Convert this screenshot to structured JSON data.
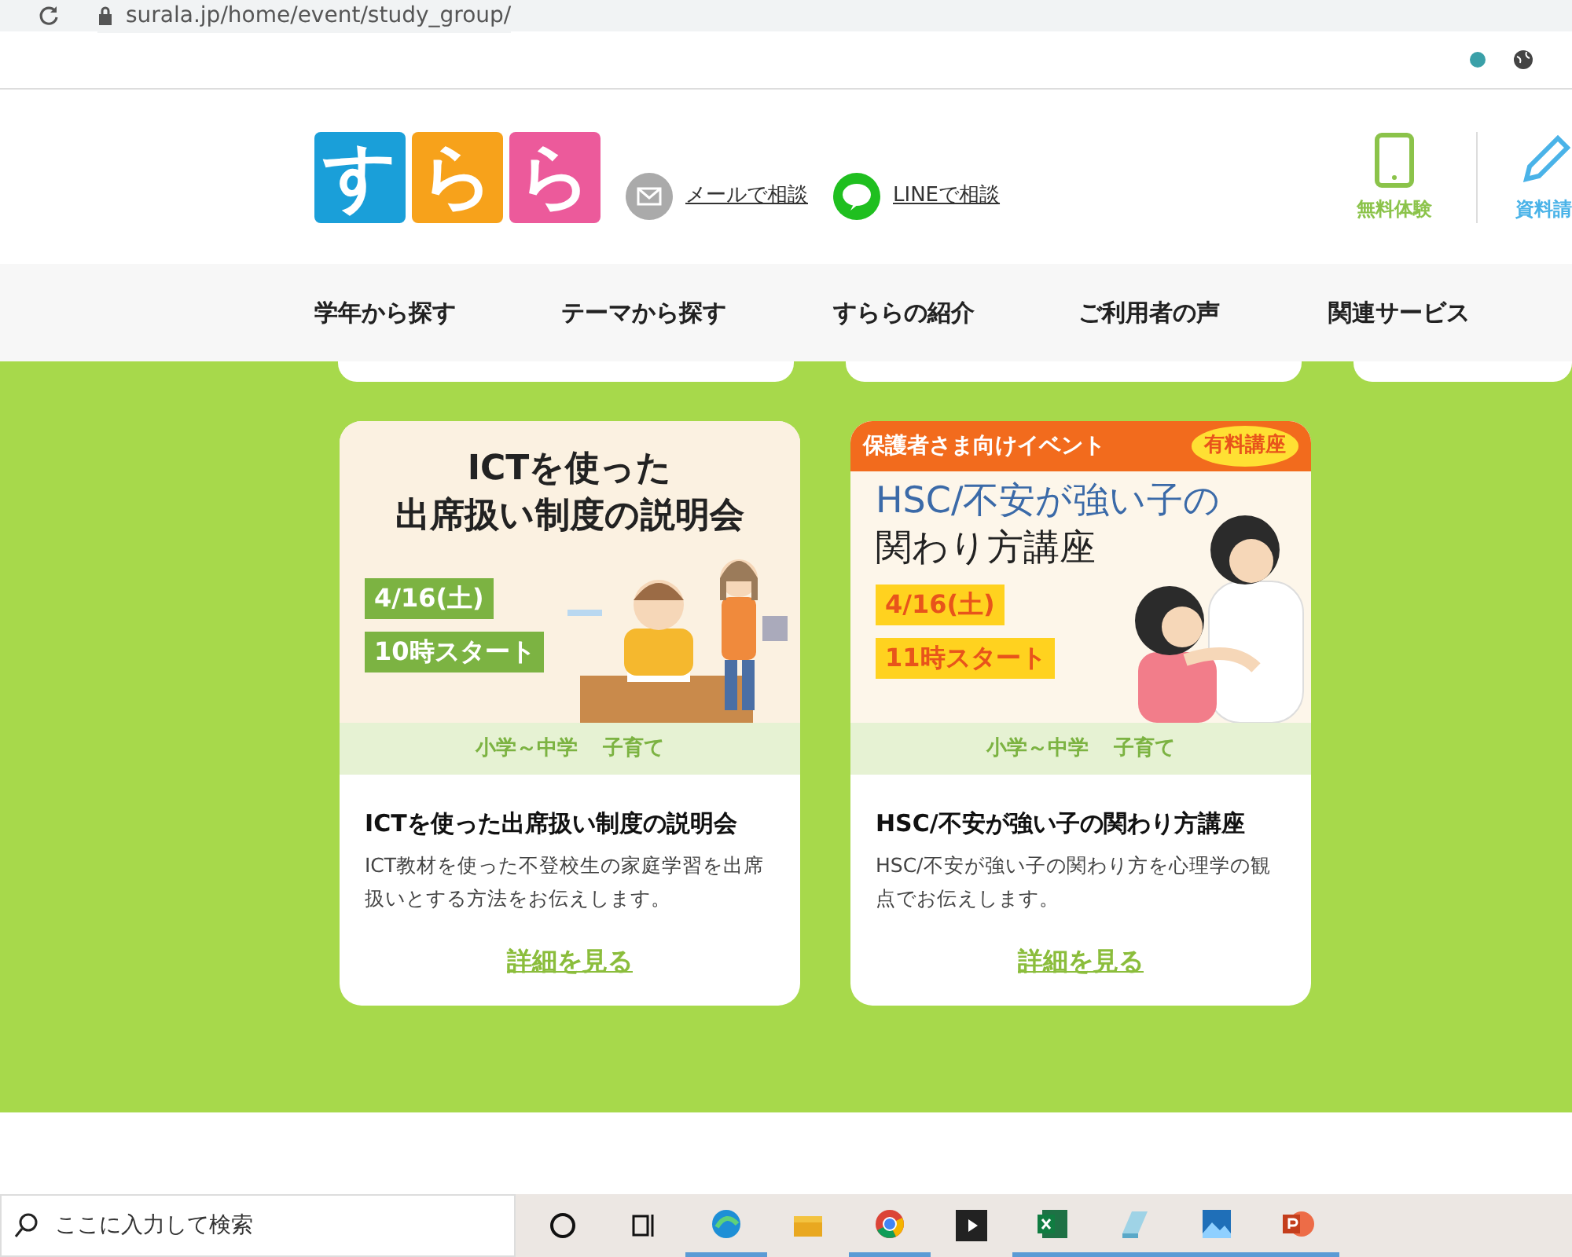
{
  "browser": {
    "url": "surala.jp/home/event/study_group/"
  },
  "header": {
    "logo_letters": [
      "す",
      "ら",
      "ら"
    ],
    "contact_links": [
      {
        "kind": "mail",
        "label": "メールで相談"
      },
      {
        "kind": "line",
        "label": "LINEで相談"
      }
    ],
    "actions": [
      {
        "kind": "tablet",
        "label": "無料体験"
      },
      {
        "kind": "pencil",
        "label": "資料請"
      }
    ]
  },
  "nav": [
    "学年から探す",
    "テーマから探す",
    "すららの紹介",
    "ご利用者の声",
    "関連サービス"
  ],
  "events": [
    {
      "banner": {
        "kind": "ict",
        "title_lines": [
          "ICTを使った",
          "出席扱い制度の説明会"
        ],
        "date": "4/16(土)",
        "start": "10時スタート"
      },
      "tags": [
        "小学～中学",
        "子育て"
      ],
      "title": "ICTを使った出席扱い制度の説明会",
      "description": "ICT教材を使った不登校生の家庭学習を出席扱いとする方法をお伝えします。",
      "link": "詳細を見る"
    },
    {
      "banner": {
        "kind": "hsc",
        "ribbon": "保護者さま向けイベント",
        "badge": "有料講座",
        "title_lines": [
          "HSC/不安が強い子の",
          "関わり方講座"
        ],
        "date": "4/16(土)",
        "start": "11時スタート"
      },
      "tags": [
        "小学～中学",
        "子育て"
      ],
      "title": "HSC/不安が強い子の関わり方講座",
      "description": "HSC/不安が強い子の関わり方を心理学の観点でお伝えします。",
      "link": "詳細を見る"
    }
  ],
  "taskbar": {
    "search": {
      "placeholder": "ここに入力して検索"
    },
    "apps": [
      {
        "kind": "cortana",
        "running": false
      },
      {
        "kind": "taskview",
        "running": false
      },
      {
        "kind": "edge",
        "running": true
      },
      {
        "kind": "folder",
        "running": false
      },
      {
        "kind": "chrome",
        "running": true
      },
      {
        "kind": "media",
        "running": false
      },
      {
        "kind": "excel",
        "running": true
      },
      {
        "kind": "notepad",
        "running": true
      },
      {
        "kind": "photos",
        "running": true
      },
      {
        "kind": "powerpoint",
        "running": true
      }
    ]
  }
}
